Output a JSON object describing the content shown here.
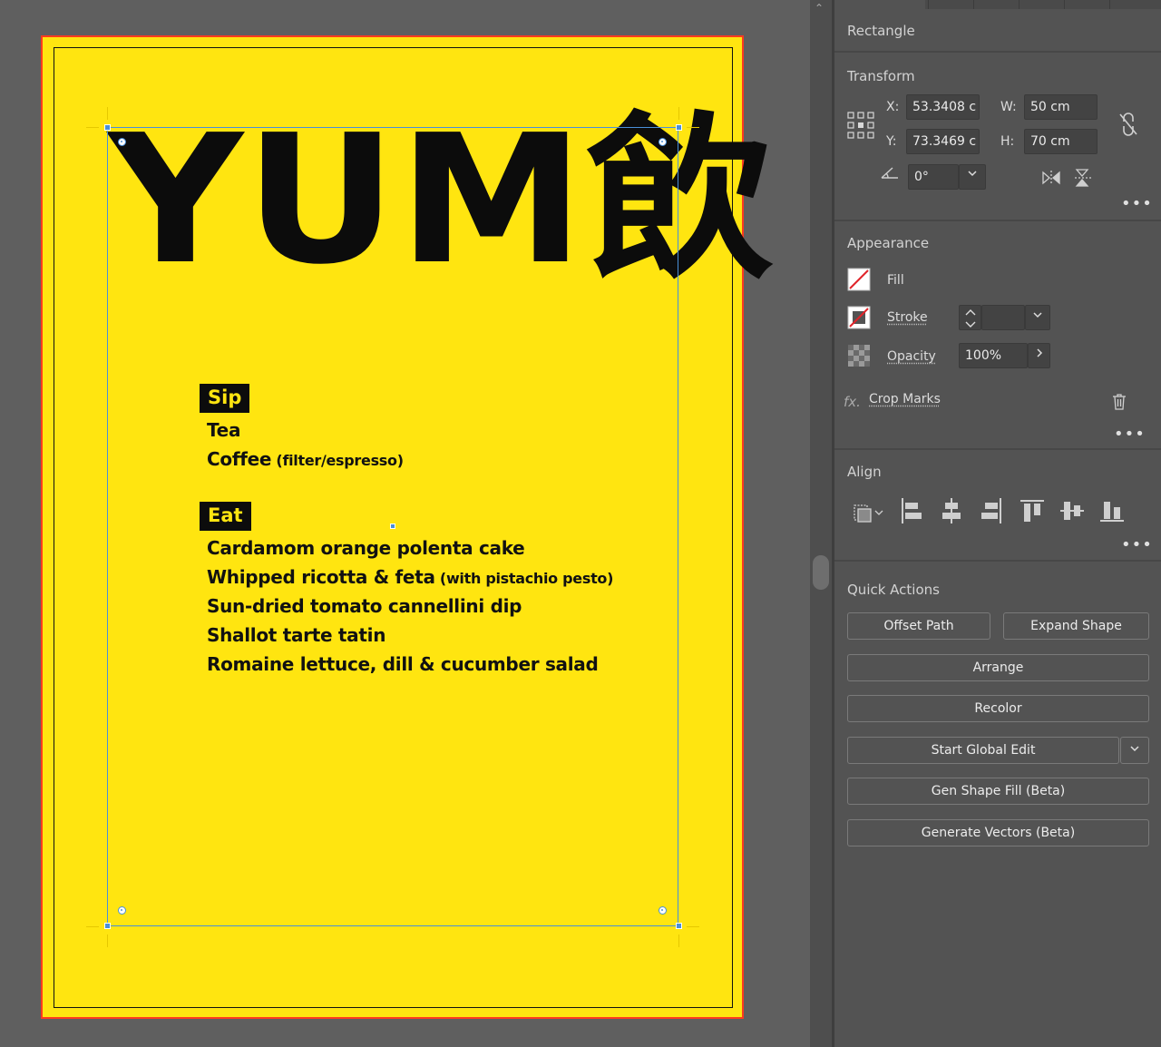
{
  "artboard": {
    "headline": "YUM飲",
    "sections": [
      {
        "badge": "Sip",
        "items": [
          {
            "text": "Tea",
            "note": ""
          },
          {
            "text": "Coffee",
            "note": " (filter/espresso)"
          }
        ]
      },
      {
        "badge": "Eat",
        "items": [
          {
            "text": "Cardamom orange polenta cake",
            "note": ""
          },
          {
            "text": "Whipped ricotta & feta",
            "note": " (with pistachio pesto)"
          },
          {
            "text": "Sun-dried tomato cannellini dip",
            "note": ""
          },
          {
            "text": "Shallot tarte tatin",
            "note": ""
          },
          {
            "text": "Romaine lettuce, dill & cucumber salad",
            "note": ""
          }
        ]
      }
    ]
  },
  "panel": {
    "selection_type": "Rectangle",
    "transform": {
      "title": "Transform",
      "x_label": "X:",
      "x_value": "53.3408 c",
      "y_label": "Y:",
      "y_value": "73.3469 c",
      "w_label": "W:",
      "w_value": "50 cm",
      "h_label": "H:",
      "h_value": "70 cm",
      "angle_value": "0°"
    },
    "appearance": {
      "title": "Appearance",
      "fill_label": "Fill",
      "stroke_label": "Stroke",
      "opacity_label": "Opacity",
      "opacity_value": "100%",
      "effect_label": "Crop Marks",
      "fx_label": "fx."
    },
    "align": {
      "title": "Align"
    },
    "quick_actions": {
      "title": "Quick Actions",
      "offset_path": "Offset Path",
      "expand_shape": "Expand Shape",
      "arrange": "Arrange",
      "recolor": "Recolor",
      "start_global_edit": "Start Global Edit",
      "gen_shape_fill": "Gen Shape Fill (Beta)",
      "generate_vectors": "Generate Vectors (Beta)"
    }
  },
  "colors": {
    "artboard": "#ffe510",
    "artboard_border": "#ff3b1f",
    "selection": "#4a8fd8",
    "panel_bg": "#535353",
    "pasteboard": "#5f5f5f"
  }
}
